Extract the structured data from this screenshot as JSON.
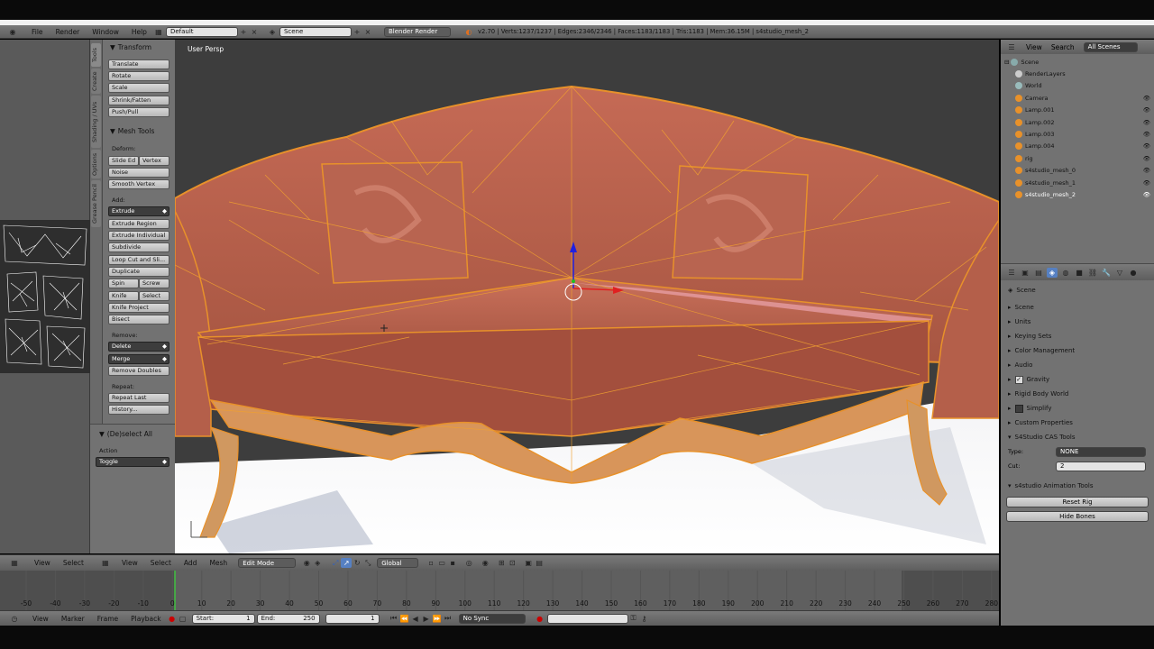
{
  "menubar": {
    "file": "File",
    "render": "Render",
    "window": "Window",
    "help": "Help",
    "layout": "Default",
    "scene": "Scene",
    "engine": "Blender Render",
    "stats": "v2.70 | Verts:1237/1237 | Edges:2346/2346 | Faces:1183/1183 | Tris:1183 | Mem:36.15M | s4studio_mesh_2"
  },
  "viewport": {
    "label": "User Persp"
  },
  "tools": {
    "tabs": [
      "Tools",
      "Create",
      "Shading / UVs",
      "Options",
      "Grease Pencil"
    ],
    "transform_header": "Transform",
    "translate": "Translate",
    "rotate": "Rotate",
    "scale": "Scale",
    "shrink": "Shrink/Fatten",
    "push": "Push/Pull",
    "mesh_header": "Mesh Tools",
    "deform": "Deform:",
    "slide_edge": "Slide Ed",
    "vertex": "Vertex",
    "noise": "Noise",
    "smooth": "Smooth Vertex",
    "add": "Add:",
    "extrude": "Extrude",
    "extrude_region": "Extrude Region",
    "extrude_individual": "Extrude Individual",
    "subdivide": "Subdivide",
    "loopcut": "Loop Cut and Sli...",
    "duplicate": "Duplicate",
    "spin": "Spin",
    "screw": "Screw",
    "knife": "Knife",
    "select": "Select",
    "knife_project": "Knife Project",
    "bisect": "Bisect",
    "remove": "Remove:",
    "delete": "Delete",
    "merge": "Merge",
    "remove_doubles": "Remove Doubles",
    "repeat": "Repeat:",
    "repeat_last": "Repeat Last",
    "history": "History...",
    "deselect_header": "(De)select All",
    "action_label": "Action",
    "action_value": "Toggle"
  },
  "outliner": {
    "view": "View",
    "search": "Search",
    "filter": "All Scenes",
    "items": [
      "Scene",
      "RenderLayers",
      "World",
      "Camera",
      "Lamp.001",
      "Lamp.002",
      "Lamp.003",
      "Lamp.004",
      "rig",
      "s4studio_mesh_0",
      "s4studio_mesh_1",
      "s4studio_mesh_2"
    ]
  },
  "properties": {
    "context": "Scene",
    "panels": [
      "Scene",
      "Units",
      "Keying Sets",
      "Color Management",
      "Audio",
      "Gravity",
      "Rigid Body World",
      "Simplify",
      "Custom Properties"
    ],
    "cas_header": "S4Studio CAS Tools",
    "type_label": "Type:",
    "type_value": "NONE",
    "cut_label": "Cut:",
    "cut_value": "2",
    "anim_header": "s4studio Animation Tools",
    "reset_rig": "Reset Rig",
    "hide_bones": "Hide Bones"
  },
  "header3d": {
    "view": "View",
    "select": "Select",
    "add": "Add",
    "mesh": "Mesh",
    "mode": "Edit Mode",
    "orientation": "Global",
    "left_view": "View",
    "left_select": "Select"
  },
  "timeline": {
    "ticks": [
      "-50",
      "-40",
      "-30",
      "-20",
      "-10",
      "0",
      "10",
      "20",
      "30",
      "40",
      "50",
      "60",
      "70",
      "80",
      "90",
      "100",
      "110",
      "120",
      "130",
      "140",
      "150",
      "160",
      "170",
      "180",
      "190",
      "200",
      "210",
      "220",
      "230",
      "240",
      "250",
      "260",
      "270",
      "280"
    ]
  },
  "timebar": {
    "view": "View",
    "marker": "Marker",
    "frame": "Frame",
    "playback": "Playback",
    "start_label": "Start:",
    "start": "1",
    "end_label": "End:",
    "end": "250",
    "current": "1",
    "sync": "No Sync"
  },
  "colors": {
    "accent": "#e8912a",
    "selected": "#5680c2"
  }
}
